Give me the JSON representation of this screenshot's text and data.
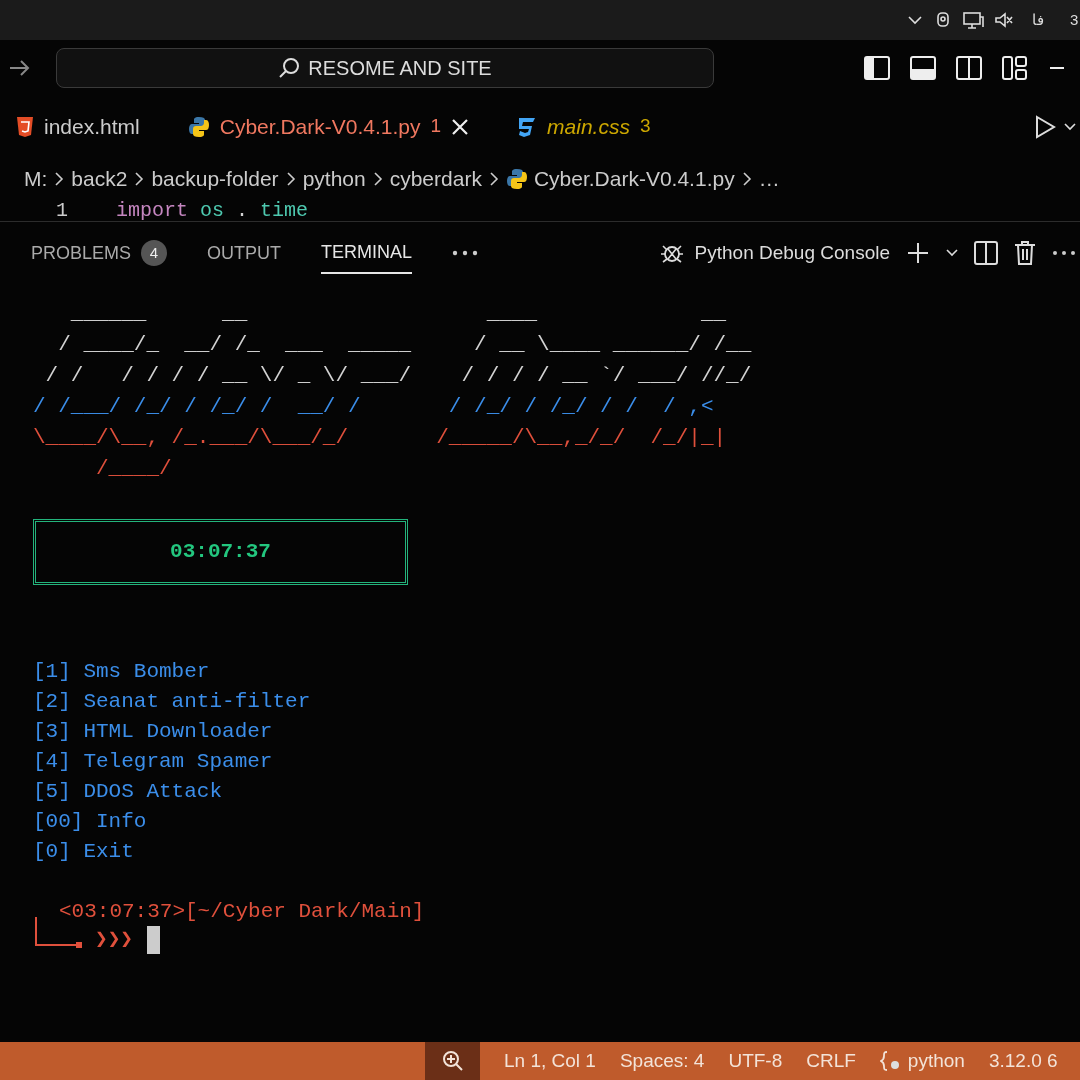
{
  "system_tray": {
    "keyboard_layout": "فا",
    "clock": "3"
  },
  "title_bar": {
    "search": "RESOME AND SITE"
  },
  "tabs": [
    {
      "label": "index.html",
      "kind": "html",
      "color": "#cccccc",
      "preview": false,
      "selected": false
    },
    {
      "label": "Cyber.Dark-V0.4.1.py",
      "kind": "python",
      "badge": "1",
      "color": "#f07860",
      "preview": false,
      "selected": true
    },
    {
      "label": "main.css",
      "kind": "css",
      "badge": "3",
      "color": "#cca700",
      "preview": true,
      "selected": false
    }
  ],
  "breadcrumb": [
    {
      "label": "M:",
      "kind": "folder"
    },
    {
      "label": "back2",
      "kind": "folder"
    },
    {
      "label": "backup-folder",
      "kind": "folder"
    },
    {
      "label": "python",
      "kind": "folder"
    },
    {
      "label": "cyberdark",
      "kind": "folder"
    },
    {
      "label": "Cyber.Dark-V0.4.1.py",
      "kind": "python"
    },
    {
      "label": "…",
      "kind": "symbol"
    }
  ],
  "editor": {
    "line_number": "1",
    "tokens": [
      {
        "text": "import",
        "kind": "keyword"
      },
      {
        "text": "os",
        "kind": "module"
      },
      {
        "text": ".",
        "kind": "punct"
      },
      {
        "text": "time",
        "kind": "module"
      }
    ]
  },
  "panel": {
    "tabs": [
      {
        "label": "PROBLEMS",
        "badge": "4",
        "selected": false
      },
      {
        "label": "OUTPUT",
        "selected": false
      },
      {
        "label": "TERMINAL",
        "selected": true
      }
    ],
    "terminal_name": "Python Debug Console"
  },
  "terminal": {
    "banner": [
      {
        "text": "   ______      __                   ____             __",
        "color": "#d4d4d4"
      },
      {
        "text": "  / ____/_  __/ /_  ___  _____     / __ \\____ ______/ /__",
        "color": "#d4d4d4"
      },
      {
        "text": " / /   / / / / __ \\/ _ \\/ ___/    / / / / __ `/ ___/ //_/",
        "color": "#d4d4d4"
      },
      {
        "text": "/ /___/ /_/ / /_/ /  __/ /       / /_/ / /_/ / /  / ,<",
        "color": "#3b8eea"
      },
      {
        "text": "\\____/\\__, /_.___/\\___/_/       /_____/\\__,_/_/  /_/|_|",
        "color": "#e0503c"
      },
      {
        "text": "     /____/",
        "color": "#e0503c"
      }
    ],
    "clock": "03:07:37",
    "menu": [
      "[1] Sms Bomber",
      "[2] Seanat anti-filter",
      "[3] HTML Downloader",
      "[4] Telegram Spamer",
      "[5] DDOS Attack",
      "[00] Info",
      "[0] Exit"
    ],
    "prompt": {
      "status": "<03:07:37>[~/Cyber Dark/Main]",
      "symbol": "❯❯❯"
    }
  },
  "status_bar": {
    "items": [
      {
        "text": "Ln 1, Col 1",
        "kind": "plain"
      },
      {
        "text": "Spaces: 4",
        "kind": "plain"
      },
      {
        "text": "UTF-8",
        "kind": "plain"
      },
      {
        "text": "CRLF",
        "kind": "plain"
      },
      {
        "text": "python",
        "kind": "language"
      },
      {
        "text": "3.12.0 6",
        "kind": "plain"
      }
    ]
  }
}
